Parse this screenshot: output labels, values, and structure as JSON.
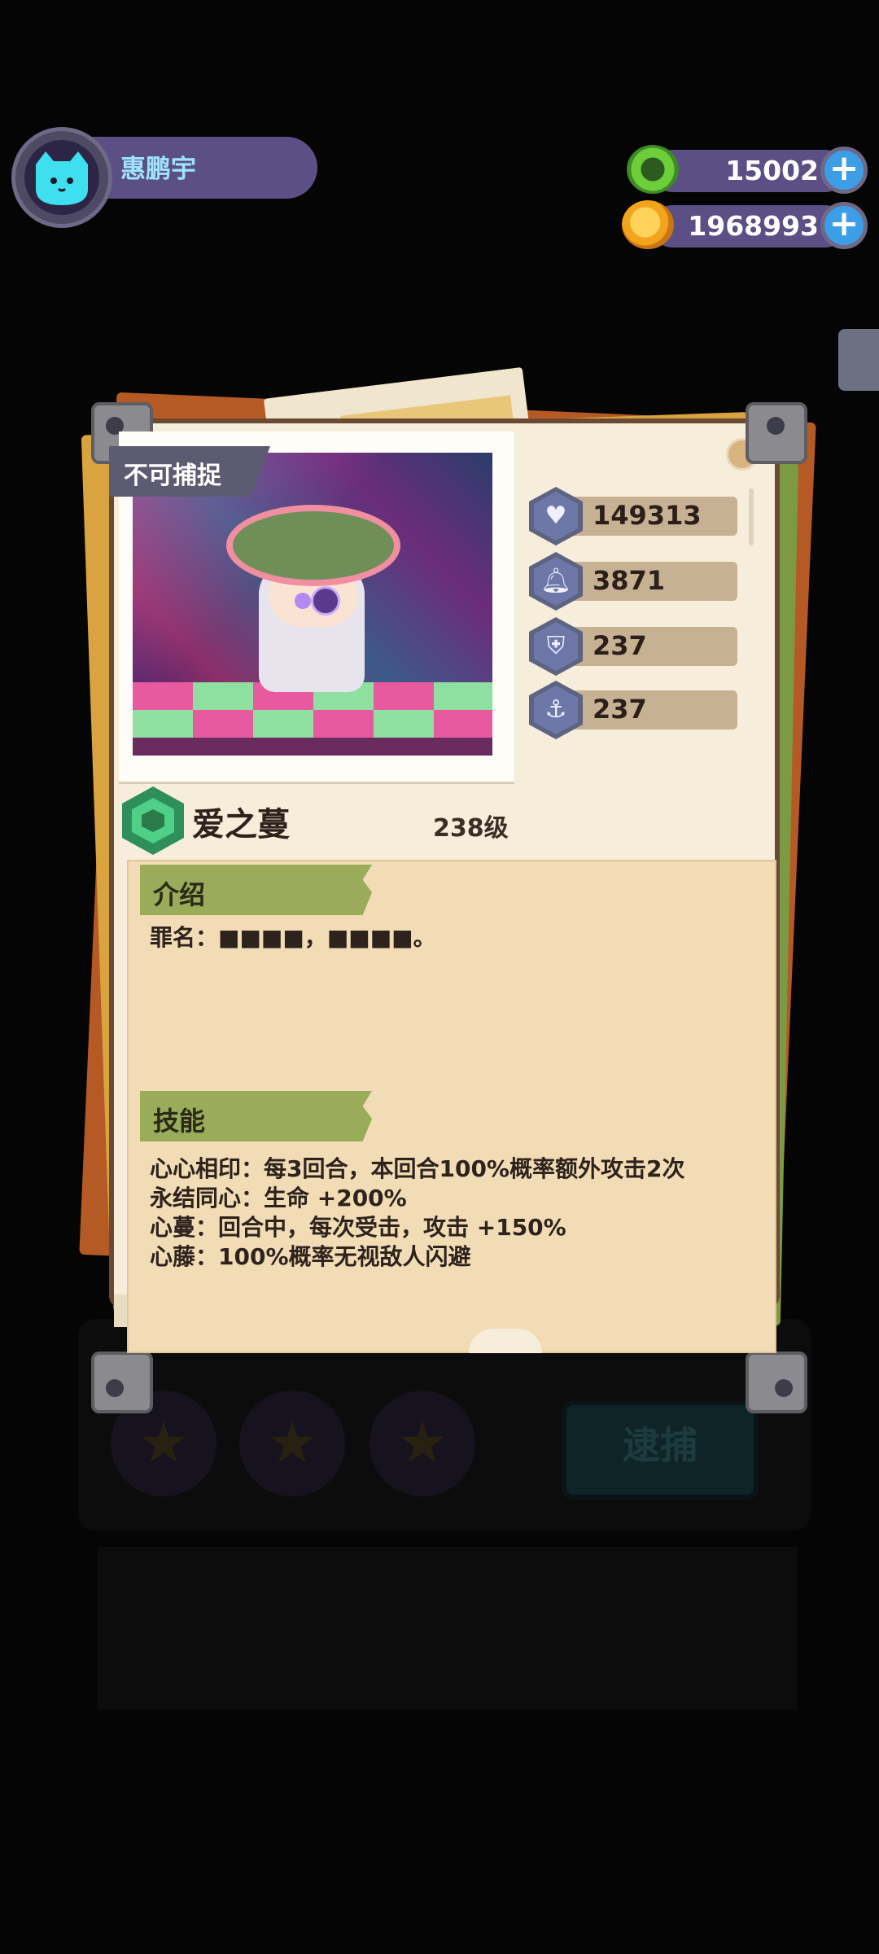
{
  "player": {
    "name": "惠鹏宇",
    "avatar_icon": "cat-face-icon"
  },
  "currencies": [
    {
      "name": "green-donut-coin",
      "value": "15002",
      "color": "#5fbf3a"
    },
    {
      "name": "gold-planet-coin",
      "value": "1968993",
      "color": "#f2a41c"
    }
  ],
  "card": {
    "capture_tag": "不可捕捉",
    "character_name": "爱之蔓",
    "level": "238级",
    "stats": [
      {
        "icon": "heart-icon",
        "value": "149313"
      },
      {
        "icon": "bell-icon",
        "value": "3871"
      },
      {
        "icon": "shield-icon",
        "value": "237"
      },
      {
        "icon": "anchor-icon",
        "value": "237"
      }
    ],
    "intro": {
      "title": "介绍",
      "text": "罪名：■■■■，■■■■。"
    },
    "skills": {
      "title": "技能",
      "lines": [
        "心心相印：每3回合，本回合100%概率额外攻击2次",
        "永结同心：生命 +200%",
        "心蔓：回合中，每次受击，攻击 +150%",
        "心藤：100%概率无视敌人闪避"
      ]
    }
  },
  "background": {
    "arrest_button": "逮捕"
  }
}
